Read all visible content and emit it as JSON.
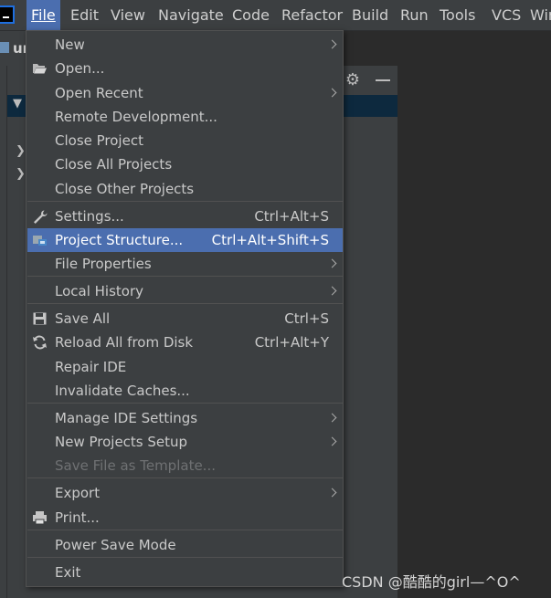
{
  "menubar": {
    "items": [
      {
        "label": "File",
        "active": true
      },
      {
        "label": "Edit"
      },
      {
        "label": "View"
      },
      {
        "label": "Navigate"
      },
      {
        "label": "Code"
      },
      {
        "label": "Refactor"
      },
      {
        "label": "Build"
      },
      {
        "label": "Run"
      },
      {
        "label": "Tools"
      },
      {
        "label": "VCS"
      },
      {
        "label": "Win"
      }
    ]
  },
  "project": {
    "name_fragment": "ur"
  },
  "colors": {
    "highlight": "#4b6eaf",
    "menu_bg": "#3c3f41",
    "editor_bg": "#2b2b2b"
  },
  "file_menu": {
    "items": [
      {
        "label": "New",
        "submenu": true
      },
      {
        "label": "Open...",
        "icon": "folder-open-icon"
      },
      {
        "label": "Open Recent",
        "submenu": true
      },
      {
        "label": "Remote Development..."
      },
      {
        "label": "Close Project"
      },
      {
        "label": "Close All Projects"
      },
      {
        "label": "Close Other Projects"
      },
      {
        "label": "Settings...",
        "shortcut": "Ctrl+Alt+S",
        "icon": "wrench-icon"
      },
      {
        "label": "Project Structure...",
        "shortcut": "Ctrl+Alt+Shift+S",
        "icon": "project-structure-icon",
        "highlighted": true
      },
      {
        "label": "File Properties",
        "submenu": true
      },
      {
        "label": "Local History",
        "submenu": true
      },
      {
        "label": "Save All",
        "shortcut": "Ctrl+S",
        "icon": "save-icon"
      },
      {
        "label": "Reload All from Disk",
        "shortcut": "Ctrl+Alt+Y",
        "icon": "reload-icon"
      },
      {
        "label": "Repair IDE"
      },
      {
        "label": "Invalidate Caches..."
      },
      {
        "label": "Manage IDE Settings",
        "submenu": true
      },
      {
        "label": "New Projects Setup",
        "submenu": true
      },
      {
        "label": "Save File as Template...",
        "disabled": true
      },
      {
        "label": "Export",
        "submenu": true
      },
      {
        "label": "Print...",
        "icon": "printer-icon"
      },
      {
        "label": "Power Save Mode"
      },
      {
        "label": "Exit"
      }
    ]
  },
  "watermark": "CSDN @酷酷的girl—^O^"
}
